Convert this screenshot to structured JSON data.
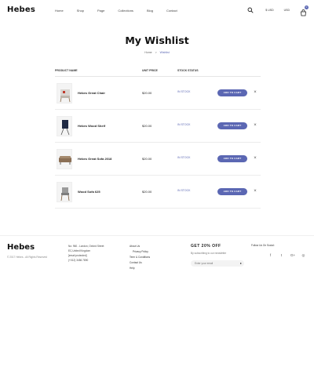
{
  "header": {
    "logo": "Hebes",
    "nav": [
      "Home",
      "Shop",
      "Page",
      "Collections",
      "Blog",
      "Contact"
    ],
    "currency": "$ USD",
    "language": "USD",
    "cart_count": "0"
  },
  "page": {
    "title": "My Wishlist",
    "breadcrumb": {
      "home": "Home",
      "separator": ">",
      "current": "Wishlist"
    }
  },
  "table": {
    "headers": {
      "product": "PRODUCT NAME",
      "price": "UNIT PRICE",
      "stock": "STOCK STATUS"
    },
    "rows": [
      {
        "name": "Hebes Great Chair",
        "price": "$20.00",
        "stock": "IN STOCK",
        "button": "ADD TO CART"
      },
      {
        "name": "Hebes Wood Shelf",
        "price": "$20.00",
        "stock": "IN STOCK",
        "button": "ADD TO CART"
      },
      {
        "name": "Hebes Great Sofa 2018",
        "price": "$20.00",
        "stock": "IN STOCK",
        "button": "ADD TO CART"
      },
      {
        "name": "Wood Sofa 625",
        "price": "$20.00",
        "stock": "IN STOCK",
        "button": "ADD TO CART"
      }
    ]
  },
  "footer": {
    "logo": "Hebes",
    "copyright": "© 2017 Hebes - All Rights Reserved",
    "contact": [
      "No: 960 - London, Oxford Street",
      "EC,United Kingdom",
      "[email protected]",
      "(+012) 3456 7890"
    ],
    "links": [
      "About Us",
      "Privacy Policy",
      "Term & Conditions",
      "Contact Us",
      "Help"
    ],
    "newsletter_title": "GET 20% OFF",
    "newsletter_desc": "By subscribing to our newsletter",
    "email_placeholder": "Enter your email",
    "follow_label": "Follow Us On Social:",
    "social_icons": [
      "facebook-icon",
      "twitter-icon",
      "google-plus-icon",
      "instagram-icon"
    ]
  },
  "colors": {
    "accent": "#5b67b3"
  }
}
